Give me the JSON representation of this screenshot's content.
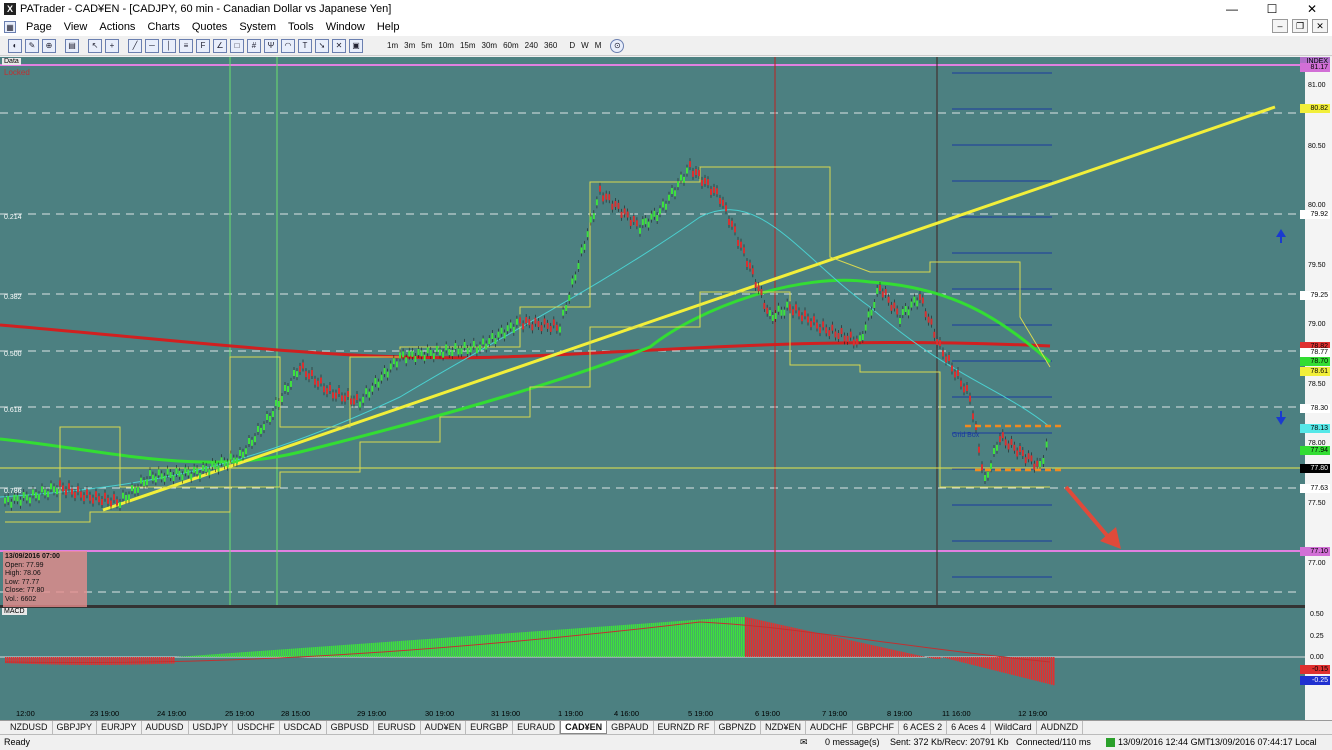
{
  "window": {
    "title": "PATrader - CAD¥EN - [CADJPY, 60 min - Canadian Dollar vs Japanese Yen]",
    "app_icon": "X",
    "controls": [
      "—",
      "☐",
      "✕"
    ]
  },
  "menu": [
    "Page",
    "View",
    "Actions",
    "Charts",
    "Quotes",
    "System",
    "Tools",
    "Window",
    "Help"
  ],
  "toolbar": {
    "timeframes": [
      "1m",
      "3m",
      "5m",
      "10m",
      "15m",
      "30m",
      "60m",
      "240",
      "360",
      "D",
      "W",
      "M"
    ]
  },
  "chart": {
    "top_left_label": "Data",
    "locked_label": "Locked",
    "fib_labels": [
      "0.214",
      "0.382",
      "0.500",
      "0.618",
      "0.786"
    ],
    "annotation": "Grid Box",
    "price_axis": [
      "81.00",
      "80.50",
      "80.00",
      "79.50",
      "79.00",
      "78.50",
      "78.00",
      "77.50",
      "77.00"
    ],
    "price_tags": [
      {
        "text": "INDEX",
        "bg": "#b070c8"
      },
      {
        "text": "81.17",
        "bg": "#d26fd6"
      },
      {
        "text": "80.82",
        "bg": "#f2ef3a"
      },
      {
        "text": "79.92",
        "bg": "#ffffff"
      },
      {
        "text": "79.25",
        "bg": "#ffffff"
      },
      {
        "text": "78.82",
        "bg": "#e03030"
      },
      {
        "text": "78.77",
        "bg": "#ffffff"
      },
      {
        "text": "78.70",
        "bg": "#33dd33"
      },
      {
        "text": "78.61",
        "bg": "#f2ef3a"
      },
      {
        "text": "78.30",
        "bg": "#ffffff"
      },
      {
        "text": "78.13",
        "bg": "#55e8e8"
      },
      {
        "text": "77.94",
        "bg": "#33dd33"
      },
      {
        "text": "77.80",
        "bg": "#000000",
        "color": "#ffffff"
      },
      {
        "text": "77.63",
        "bg": "#ffffff"
      },
      {
        "text": "77.10",
        "bg": "#d26fd6"
      }
    ],
    "info_box": {
      "date": "13/09/2016 07:00",
      "open": "Open: 77.99",
      "high": "High: 78.06",
      "low": "Low: 77.77",
      "close": "Close: 77.80",
      "vol": "Vol.: 6602"
    },
    "macd_label": "MACD",
    "macd_axis": [
      "0.50",
      "0.25",
      "0.00",
      "-0.25"
    ],
    "macd_tags": [
      {
        "text": "-0.15",
        "bg": "#e03030"
      },
      {
        "text": "-0.25",
        "bg": "#2030d0"
      }
    ],
    "x_axis": [
      "12:00",
      "23 19:00",
      "24 19:00",
      "25 19:00",
      "28 15:00",
      "29 19:00",
      "30 19:00",
      "31 19:00",
      "1 19:00",
      "4 16:00",
      "5 19:00",
      "6 19:00",
      "7 19:00",
      "8 19:00",
      "11 16:00",
      "12 19:00"
    ]
  },
  "tabs": [
    "NZDUSD",
    "GBPJPY",
    "EURJPY",
    "AUDUSD",
    "USDJPY",
    "USDCHF",
    "USDCAD",
    "GBPUSD",
    "EURUSD",
    "AUD¥EN",
    "EURGBP",
    "EURAUD",
    "CAD¥EN",
    "GBPAUD",
    "EURNZD RF",
    "GBPNZD",
    "NZD¥EN",
    "AUDCHF",
    "GBPCHF",
    "6 ACES 2",
    "6 Aces 4",
    "WildCard",
    "AUDNZD"
  ],
  "active_tab": "CAD¥EN",
  "status": {
    "ready": "Ready",
    "messages": "0 message(s)",
    "sent": "Sent: 372 Kb/Recv: 20791 Kb",
    "connected": "Connected/110 ms",
    "gmt": "13/09/2016 12:44 GMT",
    "local": "13/09/2016 07:44:17 Local"
  }
}
